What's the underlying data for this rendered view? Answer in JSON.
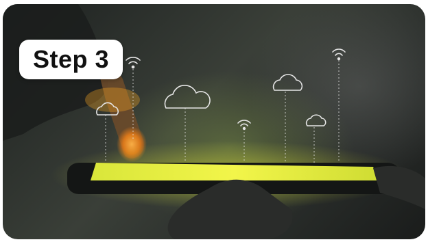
{
  "badge": {
    "label": "Step 3"
  },
  "colors": {
    "screen_glow": "#e8f03a",
    "finger_glow": "#f5a623",
    "line_art": "#e6e6e6"
  },
  "icons": [
    "cloud-icon",
    "wifi-icon",
    "phone",
    "hand",
    "finger"
  ]
}
